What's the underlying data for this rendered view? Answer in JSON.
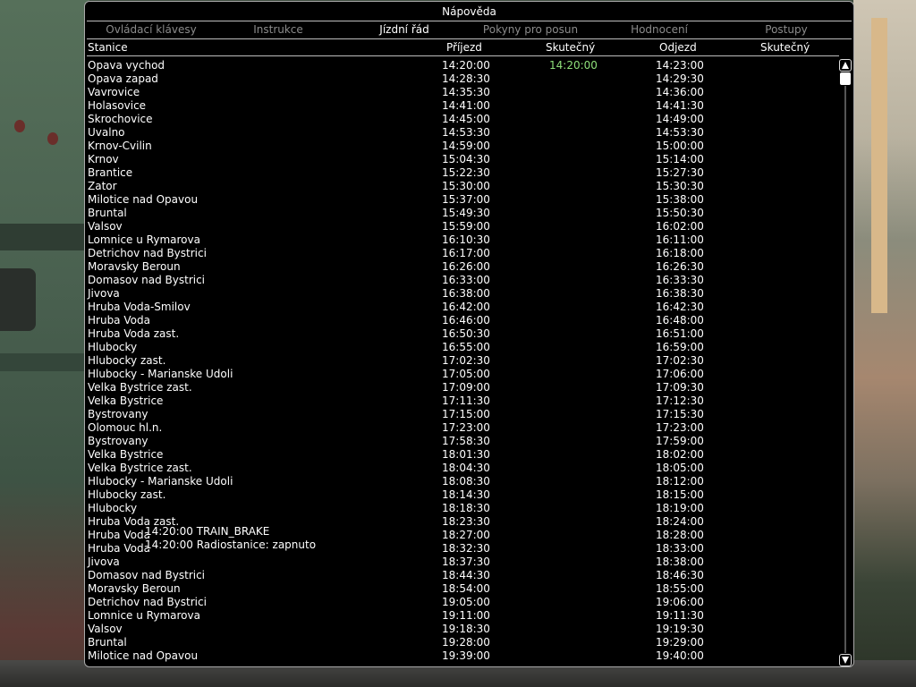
{
  "window": {
    "title": "Nápověda"
  },
  "tabs": [
    {
      "label": "Ovládací klávesy",
      "active": false
    },
    {
      "label": "Instrukce",
      "active": false
    },
    {
      "label": "Jízdní řád",
      "active": true
    },
    {
      "label": "Pokyny pro posun",
      "active": false
    },
    {
      "label": "Hodnocení",
      "active": false
    },
    {
      "label": "Postupy",
      "active": false
    }
  ],
  "columns": {
    "station": "Stanice",
    "arrival": "Příjezd",
    "actual_arrival": "Skutečný",
    "departure": "Odjezd",
    "actual_departure": "Skutečný"
  },
  "timetable": [
    {
      "station": "Opava vychod",
      "arrival": "14:20:00",
      "actual_arrival": "14:20:00",
      "departure": "14:23:00",
      "actual_departure": ""
    },
    {
      "station": "Opava zapad",
      "arrival": "14:28:30",
      "actual_arrival": "",
      "departure": "14:29:30",
      "actual_departure": ""
    },
    {
      "station": "Vavrovice",
      "arrival": "14:35:30",
      "actual_arrival": "",
      "departure": "14:36:00",
      "actual_departure": ""
    },
    {
      "station": "Holasovice",
      "arrival": "14:41:00",
      "actual_arrival": "",
      "departure": "14:41:30",
      "actual_departure": ""
    },
    {
      "station": "Skrochovice",
      "arrival": "14:45:00",
      "actual_arrival": "",
      "departure": "14:49:00",
      "actual_departure": ""
    },
    {
      "station": "Uvalno",
      "arrival": "14:53:30",
      "actual_arrival": "",
      "departure": "14:53:30",
      "actual_departure": ""
    },
    {
      "station": "Krnov-Cvilin",
      "arrival": "14:59:00",
      "actual_arrival": "",
      "departure": "15:00:00",
      "actual_departure": ""
    },
    {
      "station": "Krnov",
      "arrival": "15:04:30",
      "actual_arrival": "",
      "departure": "15:14:00",
      "actual_departure": ""
    },
    {
      "station": "Brantice",
      "arrival": "15:22:30",
      "actual_arrival": "",
      "departure": "15:27:30",
      "actual_departure": ""
    },
    {
      "station": "Zator",
      "arrival": "15:30:00",
      "actual_arrival": "",
      "departure": "15:30:30",
      "actual_departure": ""
    },
    {
      "station": "Milotice nad Opavou",
      "arrival": "15:37:00",
      "actual_arrival": "",
      "departure": "15:38:00",
      "actual_departure": ""
    },
    {
      "station": "Bruntal",
      "arrival": "15:49:30",
      "actual_arrival": "",
      "departure": "15:50:30",
      "actual_departure": ""
    },
    {
      "station": "Valsov",
      "arrival": "15:59:00",
      "actual_arrival": "",
      "departure": "16:02:00",
      "actual_departure": ""
    },
    {
      "station": "Lomnice u Rymarova",
      "arrival": "16:10:30",
      "actual_arrival": "",
      "departure": "16:11:00",
      "actual_departure": ""
    },
    {
      "station": "Detrichov nad Bystrici",
      "arrival": "16:17:00",
      "actual_arrival": "",
      "departure": "16:18:00",
      "actual_departure": ""
    },
    {
      "station": "Moravsky Beroun",
      "arrival": "16:26:00",
      "actual_arrival": "",
      "departure": "16:26:30",
      "actual_departure": ""
    },
    {
      "station": "Domasov nad Bystrici",
      "arrival": "16:33:00",
      "actual_arrival": "",
      "departure": "16:33:30",
      "actual_departure": ""
    },
    {
      "station": "Jivova",
      "arrival": "16:38:00",
      "actual_arrival": "",
      "departure": "16:38:30",
      "actual_departure": ""
    },
    {
      "station": "Hruba Voda-Smilov",
      "arrival": "16:42:00",
      "actual_arrival": "",
      "departure": "16:42:30",
      "actual_departure": ""
    },
    {
      "station": "Hruba Voda",
      "arrival": "16:46:00",
      "actual_arrival": "",
      "departure": "16:48:00",
      "actual_departure": ""
    },
    {
      "station": "Hruba Voda zast.",
      "arrival": "16:50:30",
      "actual_arrival": "",
      "departure": "16:51:00",
      "actual_departure": ""
    },
    {
      "station": "Hlubocky",
      "arrival": "16:55:00",
      "actual_arrival": "",
      "departure": "16:59:00",
      "actual_departure": ""
    },
    {
      "station": "Hlubocky zast.",
      "arrival": "17:02:30",
      "actual_arrival": "",
      "departure": "17:02:30",
      "actual_departure": ""
    },
    {
      "station": "Hlubocky - Marianske Udoli",
      "arrival": "17:05:00",
      "actual_arrival": "",
      "departure": "17:06:00",
      "actual_departure": ""
    },
    {
      "station": "Velka Bystrice zast.",
      "arrival": "17:09:00",
      "actual_arrival": "",
      "departure": "17:09:30",
      "actual_departure": ""
    },
    {
      "station": "Velka Bystrice",
      "arrival": "17:11:30",
      "actual_arrival": "",
      "departure": "17:12:30",
      "actual_departure": ""
    },
    {
      "station": "Bystrovany",
      "arrival": "17:15:00",
      "actual_arrival": "",
      "departure": "17:15:30",
      "actual_departure": ""
    },
    {
      "station": "Olomouc hl.n.",
      "arrival": "17:23:00",
      "actual_arrival": "",
      "departure": "17:23:00",
      "actual_departure": ""
    },
    {
      "station": "Bystrovany",
      "arrival": "17:58:30",
      "actual_arrival": "",
      "departure": "17:59:00",
      "actual_departure": ""
    },
    {
      "station": "Velka Bystrice",
      "arrival": "18:01:30",
      "actual_arrival": "",
      "departure": "18:02:00",
      "actual_departure": ""
    },
    {
      "station": "Velka Bystrice zast.",
      "arrival": "18:04:30",
      "actual_arrival": "",
      "departure": "18:05:00",
      "actual_departure": ""
    },
    {
      "station": "Hlubocky - Marianske Udoli",
      "arrival": "18:08:30",
      "actual_arrival": "",
      "departure": "18:12:00",
      "actual_departure": ""
    },
    {
      "station": "Hlubocky zast.",
      "arrival": "18:14:30",
      "actual_arrival": "",
      "departure": "18:15:00",
      "actual_departure": ""
    },
    {
      "station": "Hlubocky",
      "arrival": "18:18:30",
      "actual_arrival": "",
      "departure": "18:19:00",
      "actual_departure": ""
    },
    {
      "station": "Hruba Voda zast.",
      "arrival": "18:23:30",
      "actual_arrival": "",
      "departure": "18:24:00",
      "actual_departure": ""
    },
    {
      "station": "Hruba Voda",
      "arrival": "18:27:00",
      "actual_arrival": "",
      "departure": "18:28:00",
      "actual_departure": ""
    },
    {
      "station": "Hruba Voda",
      "arrival": "18:32:30",
      "actual_arrival": "",
      "departure": "18:33:00",
      "actual_departure": ""
    },
    {
      "station": "Jivova",
      "arrival": "18:37:30",
      "actual_arrival": "",
      "departure": "18:38:00",
      "actual_departure": ""
    },
    {
      "station": "Domasov nad Bystrici",
      "arrival": "18:44:30",
      "actual_arrival": "",
      "departure": "18:46:30",
      "actual_departure": ""
    },
    {
      "station": "Moravsky Beroun",
      "arrival": "18:54:00",
      "actual_arrival": "",
      "departure": "18:55:00",
      "actual_departure": ""
    },
    {
      "station": "Detrichov nad Bystrici",
      "arrival": "19:05:00",
      "actual_arrival": "",
      "departure": "19:06:00",
      "actual_departure": ""
    },
    {
      "station": "Lomnice u Rymarova",
      "arrival": "19:11:00",
      "actual_arrival": "",
      "departure": "19:11:30",
      "actual_departure": ""
    },
    {
      "station": "Valsov",
      "arrival": "19:18:30",
      "actual_arrival": "",
      "departure": "19:19:30",
      "actual_departure": ""
    },
    {
      "station": "Bruntal",
      "arrival": "19:28:00",
      "actual_arrival": "",
      "departure": "19:29:00",
      "actual_departure": ""
    },
    {
      "station": "Milotice nad Opavou",
      "arrival": "19:39:00",
      "actual_arrival": "",
      "departure": "19:40:00",
      "actual_departure": ""
    }
  ],
  "log_messages": [
    "14:20:00 TRAIN_BRAKE",
    "14:20:00 Radiostanice: zapnuto"
  ],
  "colors": {
    "actual_time": "#8fe07a",
    "active_tab": "#ffffff",
    "inactive_tab": "#8b8b8b",
    "panel_bg": "#000000"
  },
  "icons": [
    "scroll-up-arrow-icon",
    "scroll-down-arrow-icon"
  ]
}
